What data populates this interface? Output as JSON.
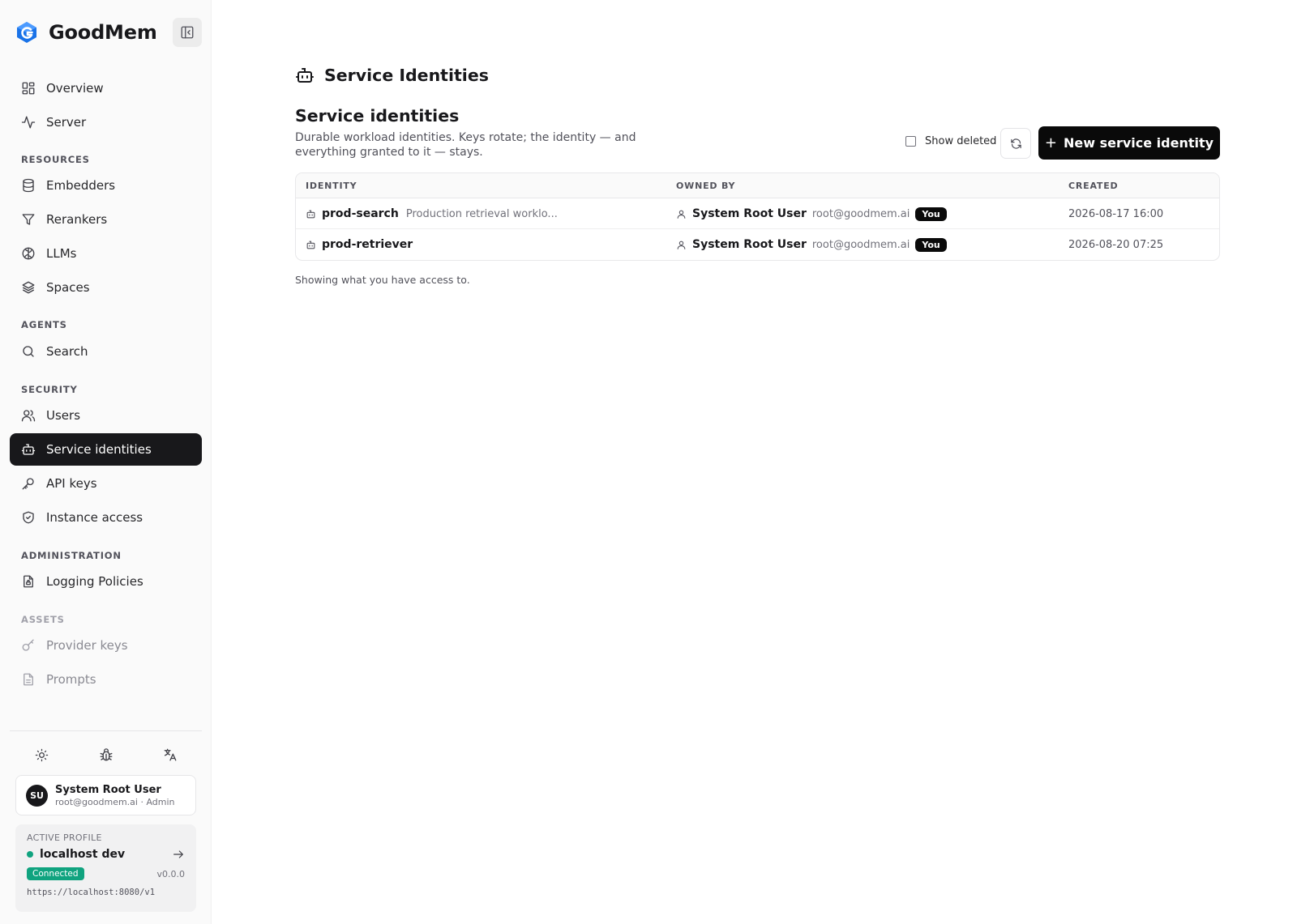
{
  "app": {
    "name": "GoodMem"
  },
  "sidebar": {
    "top_items": [
      {
        "label": "Overview",
        "icon": "layout-grid-icon"
      },
      {
        "label": "Server",
        "icon": "activity-icon"
      }
    ],
    "sections": {
      "resources": {
        "label": "RESOURCES",
        "items": [
          {
            "label": "Embedders",
            "icon": "database-icon"
          },
          {
            "label": "Rerankers",
            "icon": "filter-icon"
          },
          {
            "label": "LLMs",
            "icon": "brain-icon"
          },
          {
            "label": "Spaces",
            "icon": "layers-icon"
          }
        ]
      },
      "agents": {
        "label": "AGENTS",
        "items": [
          {
            "label": "Search",
            "icon": "search-icon"
          }
        ]
      },
      "security": {
        "label": "SECURITY",
        "items": [
          {
            "label": "Users",
            "icon": "users-icon"
          },
          {
            "label": "Service identities",
            "icon": "bot-icon",
            "active": true
          },
          {
            "label": "API keys",
            "icon": "key-icon"
          },
          {
            "label": "Instance access",
            "icon": "shield-check-icon"
          }
        ]
      },
      "administration": {
        "label": "ADMINISTRATION",
        "items": [
          {
            "label": "Logging Policies",
            "icon": "file-lock-icon"
          }
        ]
      },
      "assets": {
        "label": "ASSETS",
        "items": [
          {
            "label": "Provider keys",
            "icon": "key-round-icon"
          },
          {
            "label": "Prompts",
            "icon": "file-text-icon"
          }
        ]
      }
    },
    "user": {
      "initials": "SU",
      "name": "System Root User",
      "sub": "root@goodmem.ai · Admin"
    },
    "profile": {
      "label": "ACTIVE PROFILE",
      "name": "localhost dev",
      "status": "Connected",
      "version": "v0.0.0",
      "url": "https://localhost:8080/v1",
      "status_color": "#10a37f"
    }
  },
  "main": {
    "page_title": "Service Identities",
    "section_title": "Service identities",
    "description": "Durable workload identities. Keys rotate; the identity — and everything granted to it — stays.",
    "show_deleted_label": "Show deleted",
    "new_button_label": "New service identity",
    "table": {
      "columns": [
        "IDENTITY",
        "OWNED BY",
        "CREATED"
      ],
      "rows": [
        {
          "name": "prod-search",
          "description": "Production retrieval worklo...",
          "owner": "System Root User",
          "owner_email": "root@goodmem.ai",
          "badge": "You",
          "created": "2026-08-17 16:00"
        },
        {
          "name": "prod-retriever",
          "description": "",
          "owner": "System Root User",
          "owner_email": "root@goodmem.ai",
          "badge": "You",
          "created": "2026-08-20 07:25"
        }
      ]
    },
    "footnote": "Showing what you have access to."
  },
  "colors": {
    "accent": "#18181b",
    "connected": "#10a37f",
    "logo": "#1a73e8"
  }
}
